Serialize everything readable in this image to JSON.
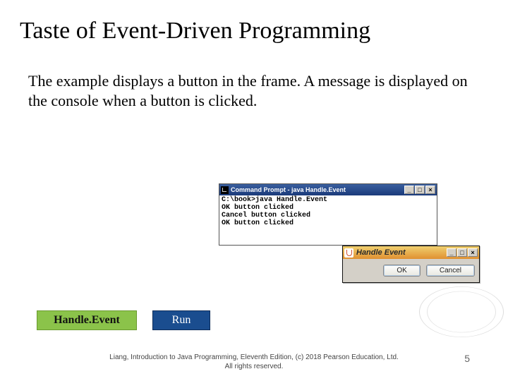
{
  "title": "Taste of Event-Driven Programming",
  "body": "The example displays a button in the frame. A message is displayed on the console when a button is clicked.",
  "cmd": {
    "title": "Command Prompt - java Handle.Event",
    "lines": "C:\\book>java Handle.Event\nOK button clicked\nCancel button clicked\nOK button clicked",
    "min": "_",
    "max": "□",
    "close": "×"
  },
  "eventWin": {
    "title": "Handle Event",
    "ok": "OK",
    "cancel": "Cancel",
    "min": "_",
    "max": "□",
    "close": "×"
  },
  "buttons": {
    "handleEvent": "Handle.Event",
    "run": "Run"
  },
  "footer": {
    "line1": "Liang, Introduction to Java Programming, Eleventh Edition, (c) 2018 Pearson Education, Ltd.",
    "line2": "All rights reserved."
  },
  "pageNum": "5"
}
